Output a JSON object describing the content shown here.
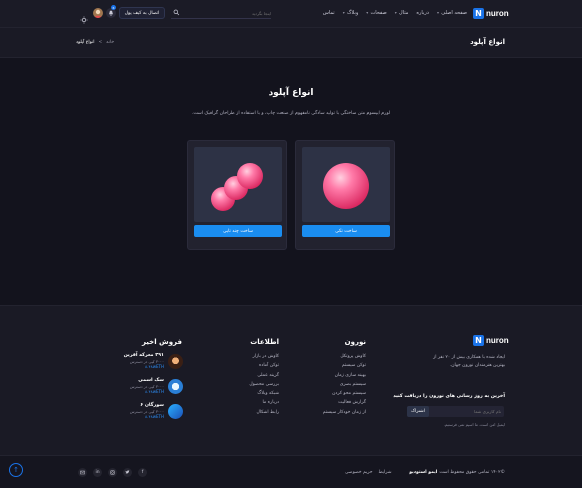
{
  "colors": {
    "accent": "#1a8df0",
    "background": "#13131d",
    "panel": "#1b1b26"
  },
  "header": {
    "logo_letter": "N",
    "logo_text": "nuron",
    "nav": [
      {
        "label": "صفحه اصلی",
        "has_chevron": true
      },
      {
        "label": "درباره",
        "has_chevron": false
      },
      {
        "label": "مثال",
        "has_chevron": true
      },
      {
        "label": "صفحات",
        "has_chevron": true
      },
      {
        "label": "وبلاگ",
        "has_chevron": true
      },
      {
        "label": "تماس",
        "has_chevron": false
      }
    ],
    "search_placeholder": "اینجا بگردید",
    "wallet_button": "اتصال به کیف پول",
    "notification_count": "6"
  },
  "banner": {
    "title": "انواع آپلود",
    "breadcrumb_home": "خانه",
    "breadcrumb_sep": ">",
    "breadcrumb_current": "انواع آپلود"
  },
  "main": {
    "title": "انواع آپلود",
    "description": "لورم ایپسوم متن ساختگی با تولید سادگی نامفهوم از صنعت چاپ، و با استفاده از طراحان گرافیک است.",
    "cards": [
      {
        "button_label": "ساخت تکی",
        "image": "single-sphere"
      },
      {
        "button_label": "ساخت چند تایی",
        "image": "multi-sphere"
      }
    ]
  },
  "footer": {
    "about": {
      "logo_letter": "N",
      "logo_text": "nuron",
      "text_line1": "ایجاد شده با همکاری بیش از ۲۰ نفر از",
      "text_line2": "بهترین هنرمندان نورون جهان.",
      "subscribe_title": "آخرین به روز رسانی های نورون را دریافت کنید",
      "email_placeholder": "نام کاربری شما",
      "subscribe_button": "اشتراک",
      "privacy_note": "ایمیل امن است. ما اسپم نمی فرستیم."
    },
    "nuron_col": {
      "title": "نورون",
      "links": [
        "کاوش پروتکل",
        "توکن سیستم",
        "بهینه سازی زمان",
        "سیستم بصری",
        "سیستم محو کردن",
        "گزارش فعالیت",
        "از زمان خودکار سیستم"
      ]
    },
    "info_col": {
      "title": "اطلاعات",
      "links": [
        "کاوش در بازار",
        "توکن آماده",
        "گزینه عملی",
        "بررسی محصول",
        "شبکه وبلاگ",
        "درباره ما",
        "رابط اشکال"
      ]
    },
    "sales_col": {
      "title": "فروش اخیر",
      "items": [
        {
          "name": "۴۹۱ معرکه آفرین",
          "meta": "۳۰۰۰ کپی در دسترس",
          "price": "۸.۴۸wETH"
        },
        {
          "name": "سک اسمی",
          "meta": "۳۰۰۰ کپی در دسترس",
          "price": "۸.۴۸wETH"
        },
        {
          "name": "سورگان ۶",
          "meta": "۳۰۰۰ کپی در دسترس",
          "price": "۸.۴۸wETH"
        }
      ]
    }
  },
  "bottombar": {
    "copyright_prefix": "©۱۴۰۲ تمامی حقوق محفوظ است",
    "copyright_brand": "ایمو استودیو",
    "links": [
      "شرایط",
      "حریم خصوصی"
    ],
    "socials": [
      "facebook-icon",
      "twitter-icon",
      "instagram-icon",
      "linkedin-icon",
      "mail-icon"
    ]
  }
}
